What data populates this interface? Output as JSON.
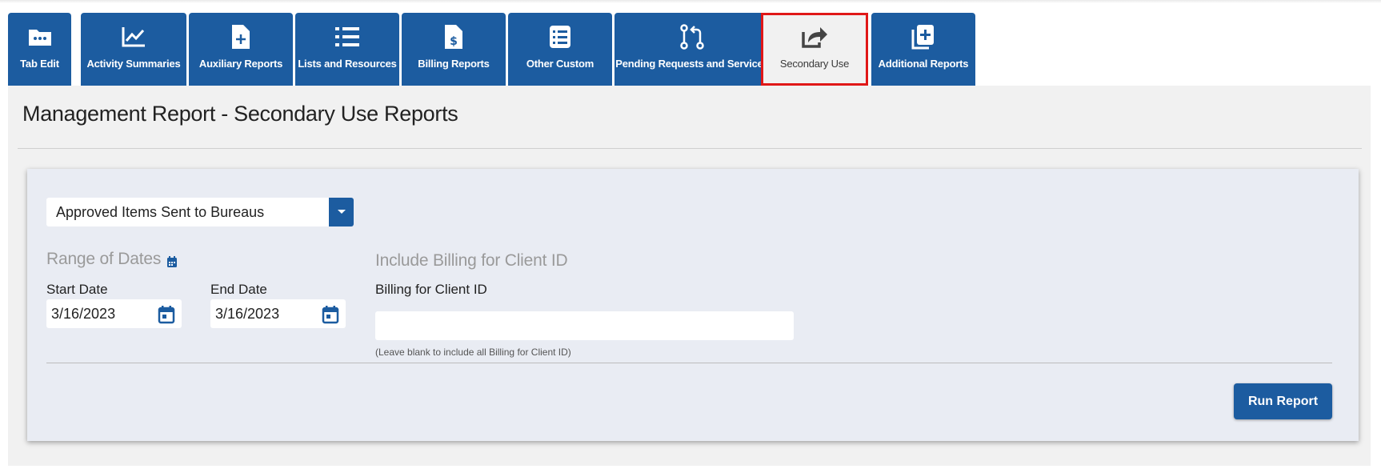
{
  "tabs": [
    {
      "label": "Tab Edit",
      "icon": "folder-icon"
    },
    {
      "label": "Activity Summaries",
      "icon": "line-chart-icon"
    },
    {
      "label": "Auxiliary Reports",
      "icon": "file-plus-icon"
    },
    {
      "label": "Lists and Resources",
      "icon": "list-icon"
    },
    {
      "label": "Billing Reports",
      "icon": "file-dollar-icon"
    },
    {
      "label": "Other Custom",
      "icon": "checklist-icon"
    },
    {
      "label": "Pending Requests and Services",
      "icon": "git-pull-request-icon"
    },
    {
      "label": "Secondary Use",
      "icon": "share-icon",
      "active": true
    },
    {
      "label": "Additional Reports",
      "icon": "files-plus-icon"
    }
  ],
  "page_title": "Management Report - Secondary Use Reports",
  "report_select": {
    "value": "Approved Items Sent to Bureaus"
  },
  "range": {
    "heading": "Range of Dates",
    "start_label": "Start Date",
    "start_value": "3/16/2023",
    "end_label": "End Date",
    "end_value": "3/16/2023"
  },
  "billing": {
    "heading": "Include Billing for Client ID",
    "label": "Billing for Client ID",
    "value": "",
    "hint": "(Leave blank to include all Billing for Client ID)"
  },
  "run_button": "Run Report",
  "colors": {
    "primary": "#1c5ca0",
    "highlight": "#e01818",
    "page_bg": "#f1f1f1",
    "card_bg": "#e9ecf3"
  }
}
